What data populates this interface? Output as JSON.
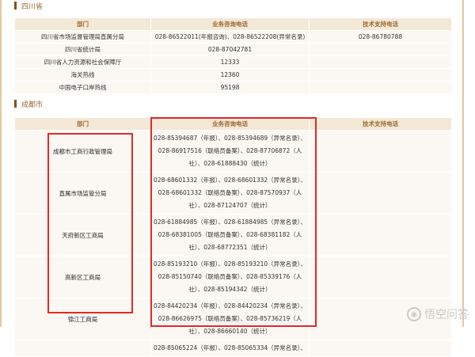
{
  "section1": {
    "title": "四川省",
    "headers": [
      "部门",
      "业务咨询电话",
      "技术支持电话"
    ],
    "rows": [
      {
        "dept": "四川省市场监督管理局直属分局",
        "phone": "028-86522011(年报咨询)、028-86522208(异常名录)",
        "tech": "028-86780788"
      },
      {
        "dept": "四川省统计局",
        "phone": "028-87042781",
        "tech": ""
      },
      {
        "dept": "四川省人力资源和社会保障厅",
        "phone": "12333",
        "tech": ""
      },
      {
        "dept": "海关热线",
        "phone": "12360",
        "tech": ""
      },
      {
        "dept": "中国电子口岸热线",
        "phone": "95198",
        "tech": ""
      }
    ]
  },
  "section2": {
    "title": "成都市",
    "headers": [
      "部门",
      "业务咨询电话",
      "技术支持电话"
    ],
    "rows": [
      {
        "dept": "成都市工商行政管理局",
        "lines": [
          "028-85394687（年报）、028-85394689（异常名录）、",
          "028-86917516（联络员备案）、028-87706872（人",
          "社）、028-61888430（统计）"
        ],
        "tech": ""
      },
      {
        "dept": "直属市场监管分局",
        "lines": [
          "028-68601332（年报）、028-68601332（异常名录）、",
          "028-68601332（联络员备案）、028-87570937（人",
          "社）、028-87124707（统计）"
        ],
        "tech": ""
      },
      {
        "dept": "天府新区工商局",
        "lines": [
          "028-61884985（年报）、028-61884985（异常名录）、",
          "028-68381005（联络员备案）、028-68381182（人",
          "社）、028-68772351（统计）"
        ],
        "tech": ""
      },
      {
        "dept": "高新区工商局",
        "lines": [
          "028-85193210（年报）、028-85193210（异常名录）、",
          "028-85150740（联络员备案）、028-85339176（人",
          "社）、028-85194342（统计）"
        ],
        "tech": ""
      },
      {
        "dept": "锦江工商局",
        "lines": [
          "028-84420234（年报）、028-84420234（异常名录）、",
          "028-86626975（联络员备案）、028-85736219（人",
          "社）、028-86660140（统计）"
        ],
        "tech": ""
      },
      {
        "dept": "",
        "lines": [
          "028-85065224（年报）、028-85065334（异常名录）、"
        ],
        "tech": ""
      }
    ]
  },
  "watermark": {
    "text": "悟空问答"
  }
}
